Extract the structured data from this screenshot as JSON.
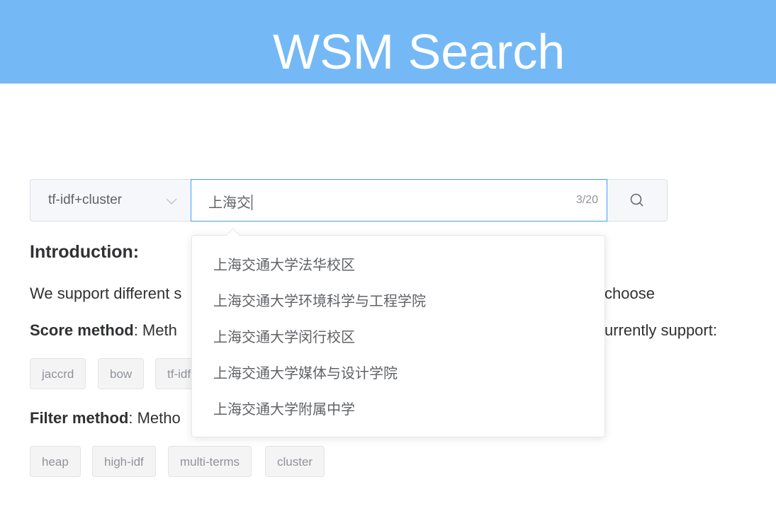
{
  "header": {
    "title": "WSM Search"
  },
  "search": {
    "method_value": "tf-idf+cluster",
    "query": "上海交",
    "count": "3/20"
  },
  "suggestions": [
    "上海交通大学法华校区",
    "上海交通大学环境科学与工程学院",
    "上海交通大学闵行校区",
    "上海交通大学媒体与设计学院",
    "上海交通大学附属中学"
  ],
  "intro": {
    "title": "Introduction:",
    "line1_start": "We support different s",
    "line1_end": "choose",
    "score_label": "Score method",
    "score_text_start": ": Meth",
    "score_text_end": "urrently support:",
    "score_tags": [
      "jaccrd",
      "bow",
      "tf-idf"
    ],
    "filter_label": "Filter method",
    "filter_text_start": ": Metho",
    "filter_tags": [
      "heap",
      "high-idf",
      "multi-terms",
      "cluster"
    ]
  },
  "colors": {
    "header_bg": "#74b9f5",
    "input_focus_border": "#409eff",
    "tag_bg": "#f4f4f5"
  },
  "icons": {
    "select_arrow": "chevron-down-icon",
    "search_button": "search-icon"
  }
}
